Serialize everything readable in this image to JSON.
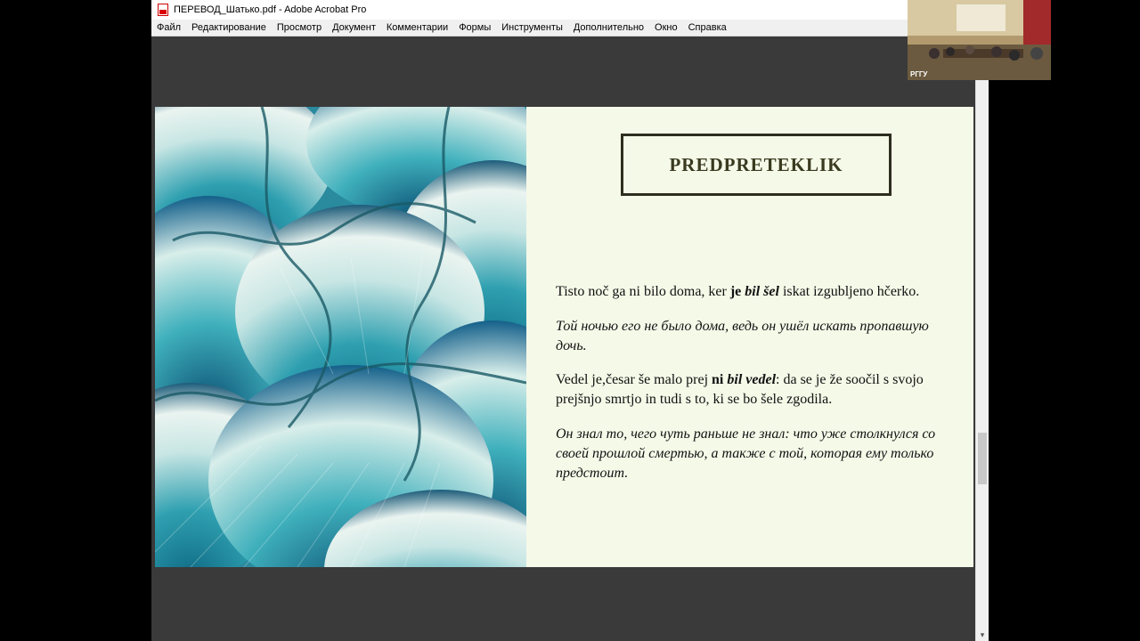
{
  "window": {
    "title": "ПЕРЕВОД_Шатько.pdf - Adobe Acrobat Pro",
    "file_icon": "pdf-file-icon"
  },
  "menu": [
    "Файл",
    "Редактирование",
    "Просмотр",
    "Документ",
    "Комментарии",
    "Формы",
    "Инструменты",
    "Дополнительно",
    "Окно",
    "Справка"
  ],
  "slide": {
    "title": "PREDPRETEKLIK",
    "p1": {
      "pre": "Tisto noč ga ni bilo doma, ker ",
      "bold1": "je ",
      "bolditalic": "bil šel",
      "post": " iskat izgubljeno hčerko."
    },
    "p2": "Той ночью его не было дома, ведь он ушёл искать пропавшую дочь.",
    "p3": {
      "pre": "Vedel je,česar še malo prej ",
      "bold1": "ni ",
      "bolditalic": "bil vedel",
      "post": ": da se je že soočil s svojo prejšnjo smrtjo in tudi s to, ki se bo šele zgodila."
    },
    "p4": "Он знал то, чего чуть раньше не знал: что уже столкнулся со своей прошлой смертью, а также с той, которая ему только предстоит."
  },
  "webcam": {
    "label": "РГГУ"
  },
  "scrollbar": {
    "down_arrow": "▾"
  },
  "colors": {
    "slide_bg": "#f5f9e8",
    "title_border": "#2e2e1e",
    "doc_bg": "#3a3a3a"
  }
}
